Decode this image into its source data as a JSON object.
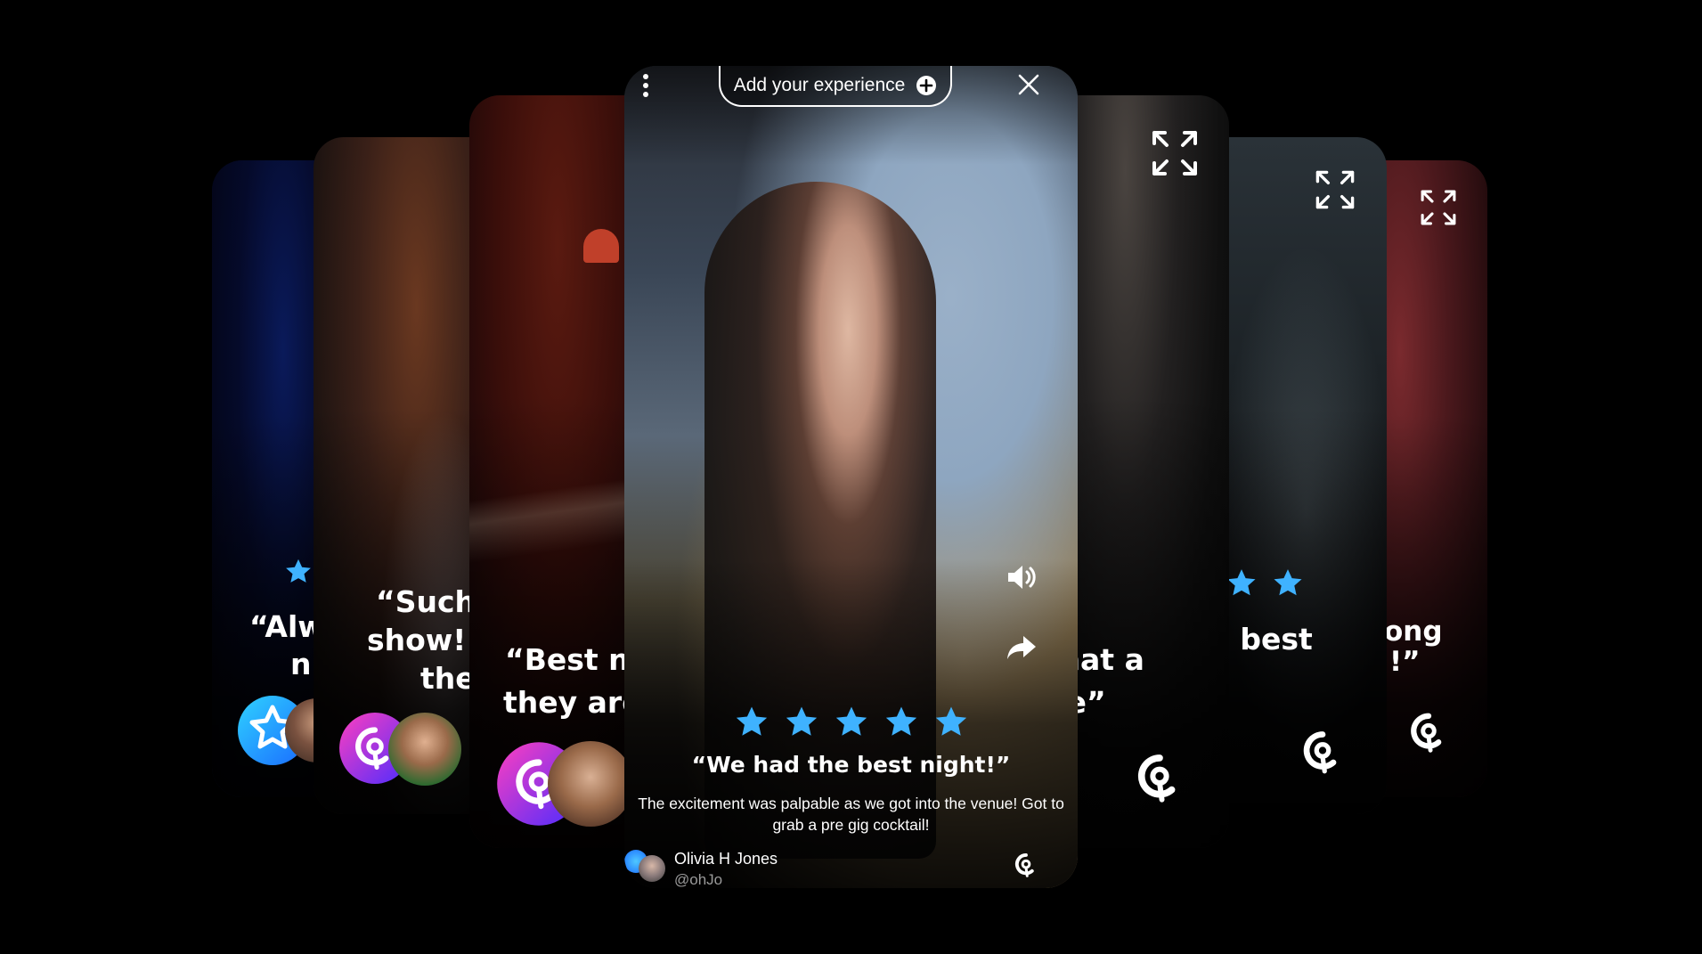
{
  "main_card": {
    "add_button_label": "Add your experience",
    "rating": 5,
    "quote": "“We had the best night!”",
    "description_line1": "The excitement was palpable as we got into the venue! Got to",
    "description_line2": "grab a pre gig cocktail!",
    "author_name": "Olivia H Jones",
    "author_handle": "@ohJo"
  },
  "side_cards": {
    "c1": {
      "quote_line1": "“Alw",
      "quote_line2": "ni"
    },
    "c2": {
      "quote_line1": "“Such",
      "quote_line2": "show! I",
      "quote_line3": "the"
    },
    "c3": {
      "quote_line1": "“Best n",
      "quote_line2": "they are"
    },
    "c5": {
      "quote_line1": "Vhat a",
      "quote_line2": "ce”"
    },
    "c6": {
      "quote_line1": "ne best",
      "quote_line2": "”"
    },
    "c7": {
      "quote_line1": "ong",
      "quote_line2": "!”"
    }
  },
  "colors": {
    "star": "#3fb2ff",
    "background": "#000000",
    "brand_gradient_start": "#ff3fbf",
    "brand_gradient_end": "#5a2cff"
  },
  "icons": [
    "more-vertical-icon",
    "plus-circle-icon",
    "close-icon",
    "volume-icon",
    "share-icon",
    "brand-logo-icon",
    "expand-icon",
    "star-icon"
  ]
}
